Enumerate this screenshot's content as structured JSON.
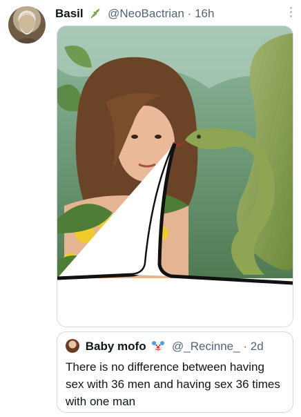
{
  "tweet": {
    "author_name": "Basil",
    "handle": "@NeoBactrian",
    "separator": "·",
    "time": "16h"
  },
  "quoted_tweet": {
    "author_name": "Baby mofo",
    "handle": "@_Recinne_",
    "separator": "·",
    "time": "2d",
    "text": "There is no difference between having sex with 36 men and having sex 36 times with one man"
  },
  "icons": {
    "verified_like_badge": "leaf-icon",
    "quoted_badge": "clown-emoji-icon",
    "overflow": "more-options-icon"
  },
  "colors": {
    "secondary_text": "#536471",
    "border": "#cfd9de"
  }
}
